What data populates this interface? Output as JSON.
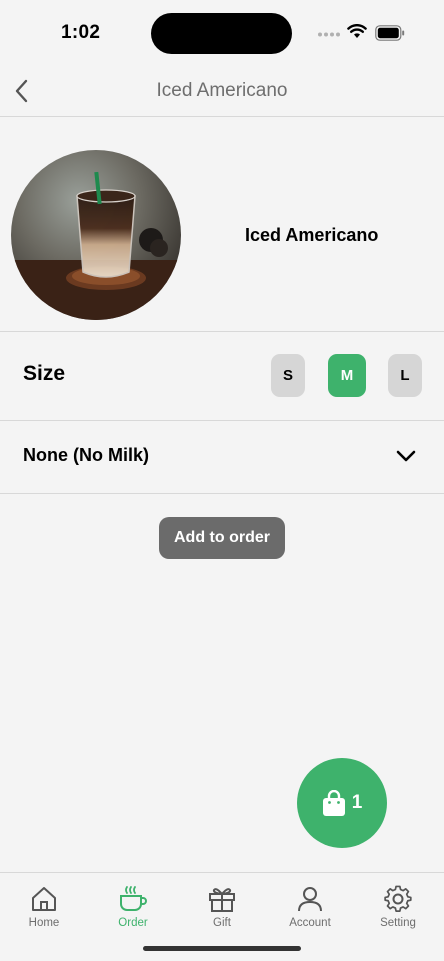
{
  "status_bar": {
    "time": "1:02"
  },
  "header": {
    "title": "Iced Americano"
  },
  "product": {
    "name": "Iced Americano",
    "image": "iced-americano-photo"
  },
  "size": {
    "label": "Size",
    "options": [
      "S",
      "M",
      "L"
    ],
    "selected": "M"
  },
  "milk": {
    "selected": "None (No Milk)"
  },
  "actions": {
    "add_to_order": "Add to order"
  },
  "cart": {
    "count": "1"
  },
  "tabs": [
    {
      "label": "Home",
      "icon": "home-icon"
    },
    {
      "label": "Order",
      "icon": "coffee-cup-icon",
      "active": true
    },
    {
      "label": "Gift",
      "icon": "gift-icon"
    },
    {
      "label": "Account",
      "icon": "person-icon"
    },
    {
      "label": "Setting",
      "icon": "gear-icon"
    }
  ],
  "colors": {
    "accent": "#3eb26c",
    "button_gray": "#6b6b6b",
    "background": "#f4f4f4"
  }
}
